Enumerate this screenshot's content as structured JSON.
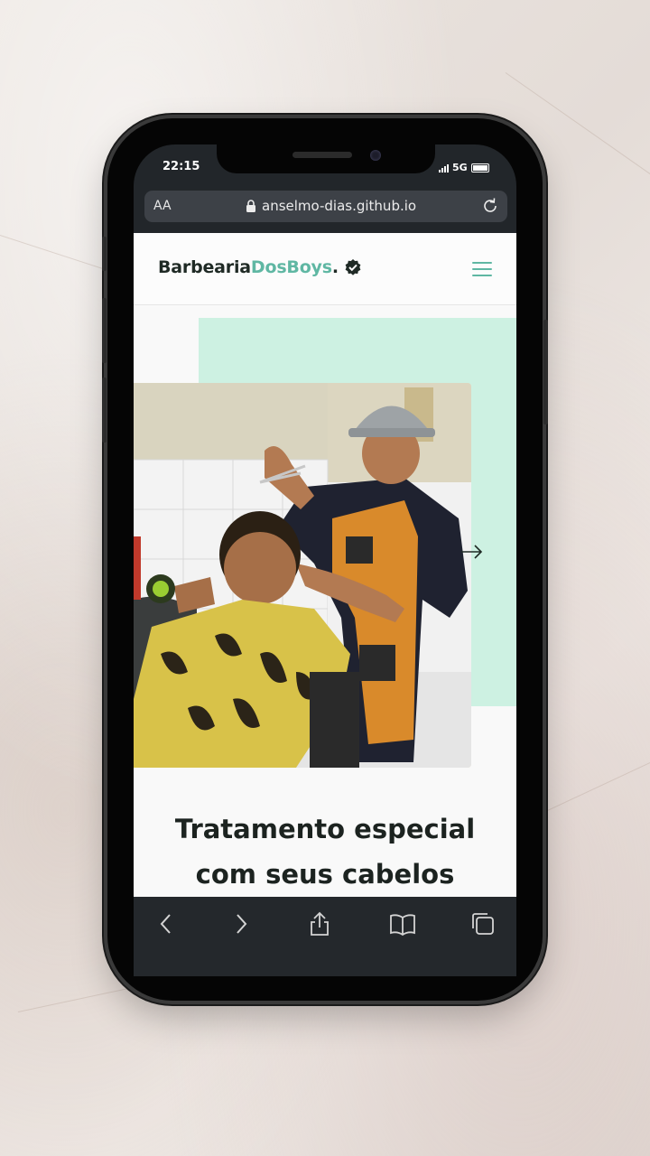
{
  "status_bar": {
    "time": "22:15",
    "network": "5G"
  },
  "browser": {
    "text_size_label": "AA",
    "url": "anselmo-dias.github.io"
  },
  "site": {
    "logo_primary": "Barbearia",
    "logo_accent": "DosBoys",
    "logo_suffix": ".",
    "headline_line1": "Tratamento especial",
    "headline_line2": "com seus cabelos"
  },
  "colors": {
    "accent": "#5fb7a3",
    "mint_panel": "#cdf1e2",
    "toolbar": "#24282c"
  },
  "icons": {
    "lock": "lock-icon",
    "reload": "reload-icon",
    "verified": "verified-badge-icon",
    "menu": "hamburger-menu-icon",
    "next": "arrow-right-icon",
    "back": "chevron-left-icon",
    "forward": "chevron-right-icon",
    "share": "share-icon",
    "bookmarks": "book-icon",
    "tabs": "tabs-icon"
  }
}
